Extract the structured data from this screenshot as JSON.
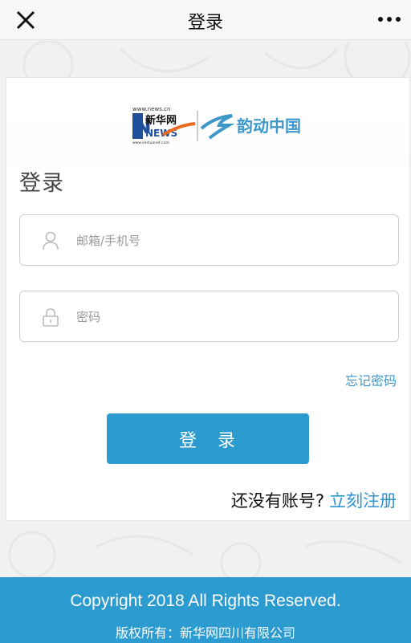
{
  "topbar": {
    "title": "登录"
  },
  "logo": {
    "site_url": "www.news.cn",
    "brand_cn": "新华网",
    "brand_en": "NEWS",
    "sub_url": "www.xinhuanet.com",
    "partner": "韵动中国"
  },
  "login": {
    "heading": "登录",
    "email_placeholder": "邮箱/手机号",
    "password_placeholder": "密码",
    "forgot": "忘记密码",
    "submit": "登　录",
    "no_account": "还没有账号?",
    "register": "立刻注册"
  },
  "footer": {
    "copyright": "Copyright 2018 All Rights Reserved.",
    "owner": "版权所有：新华网四川有限公司"
  },
  "colors": {
    "accent": "#2b9bd0",
    "link": "#3d97c9"
  }
}
